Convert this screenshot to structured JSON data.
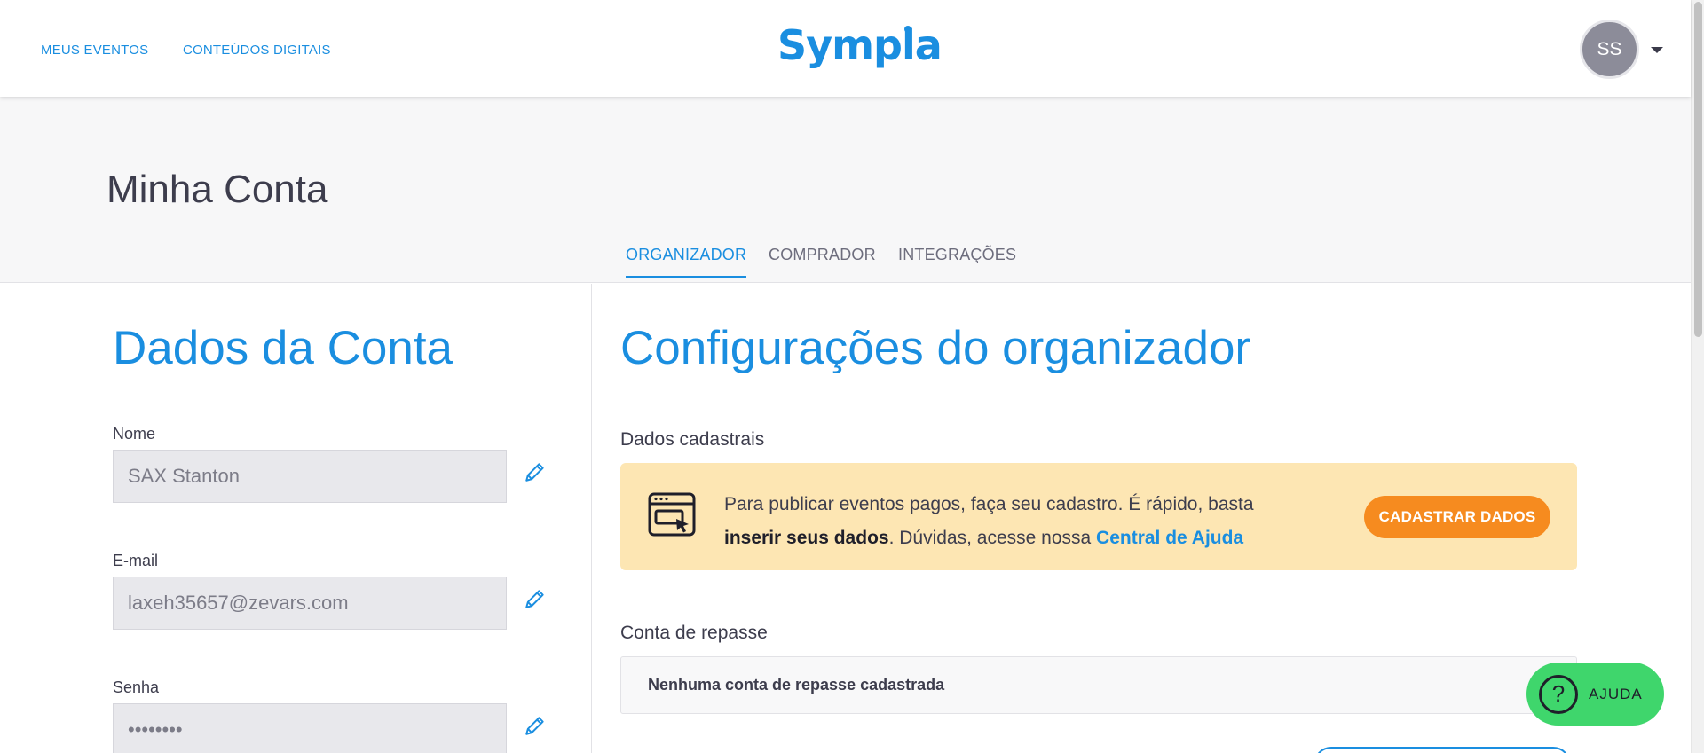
{
  "nav": {
    "links": [
      "MEUS EVENTOS",
      "CONTEÚDOS DIGITAIS"
    ],
    "logo": "Sympla",
    "avatar_initials": "SS"
  },
  "header": {
    "title": "Minha Conta",
    "tabs": [
      "ORGANIZADOR",
      "COMPRADOR",
      "INTEGRAÇÕES"
    ]
  },
  "account": {
    "title": "Dados da Conta",
    "fields": [
      {
        "label": "Nome",
        "value": "SAX Stanton"
      },
      {
        "label": "E-mail",
        "value": "laxeh35657@zevars.com"
      },
      {
        "label": "Senha",
        "value": "••••••••"
      }
    ]
  },
  "organizer": {
    "title": "Configurações do organizador",
    "registration_title": "Dados cadastrais",
    "notice_text_1": "Para publicar eventos pagos, faça seu cadastro. É rápido, basta ",
    "notice_bold": "inserir seus dados",
    "notice_text_2": ". Dúvidas, acesse nossa ",
    "notice_link": "Central de Ajuda",
    "cta_label": "CADASTRAR DADOS",
    "payout_title": "Conta de repasse",
    "payout_empty": "Nenhuma conta de repasse cadastrada"
  },
  "help": {
    "icon_glyph": "?",
    "label": "AJUDA"
  },
  "colors": {
    "brand": "#1a8ee0",
    "cta": "#f68b1f",
    "notice_bg": "#fde6b3",
    "help": "#3fd66c"
  }
}
